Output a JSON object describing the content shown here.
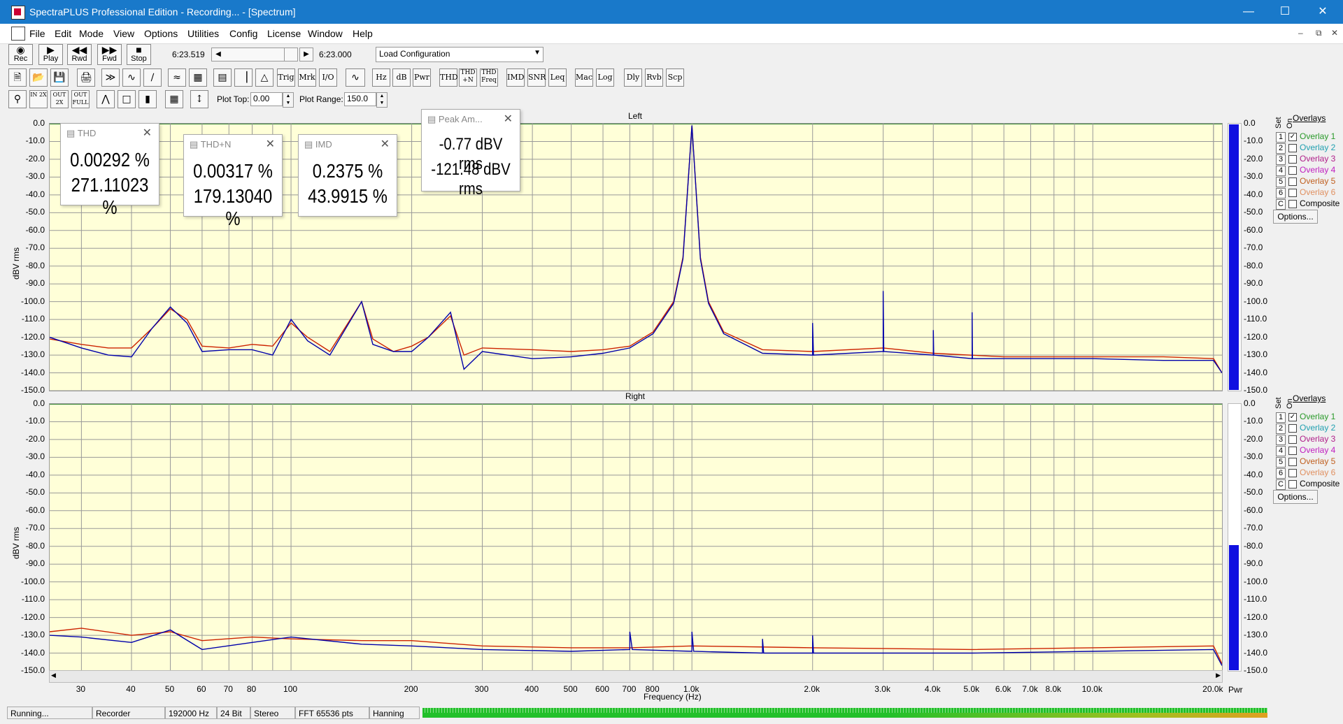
{
  "window": {
    "title": "SpectraPLUS Professional Edition - Recording... - [Spectrum]"
  },
  "menu": [
    "File",
    "Edit",
    "Mode",
    "View",
    "Options",
    "Utilities",
    "Config",
    "License",
    "Window",
    "Help"
  ],
  "transport": {
    "buttons": [
      "Rec",
      "Play",
      "Rwd",
      "Fwd",
      "Stop"
    ],
    "time_left": "6:23.519",
    "time_right": "6:23.000",
    "config_select": "Load Configuration"
  },
  "toolbar2": {
    "text_buttons": [
      "Trig",
      "Mrk",
      "I/O",
      "Hz",
      "dB",
      "Pwr",
      "THD",
      "THD +N",
      "THD Freq",
      "IMD",
      "SNR",
      "Leq",
      "Mac",
      "Log",
      "Dly",
      "Rvb",
      "Scp"
    ]
  },
  "toolbar3": {
    "zoom_buttons": [
      "IN 2X",
      "OUT 2X",
      "OUT FULL"
    ],
    "plot_top_label": "Plot Top:",
    "plot_top_value": "0.00",
    "plot_range_label": "Plot Range:",
    "plot_range_value": "150.0"
  },
  "popups": {
    "thd": {
      "title": "THD",
      "v1": "0.00292 %",
      "v2": "271.11023 %"
    },
    "thdn": {
      "title": "THD+N",
      "v1": "0.00317 %",
      "v2": "179.13040 %"
    },
    "imd": {
      "title": "IMD",
      "v1": "0.2375 %",
      "v2": "43.9915 %"
    },
    "peak": {
      "title": "Peak Am...",
      "v1": "-0.77 dBV rms",
      "v2": "-121.48 dBV rms"
    }
  },
  "overlays": {
    "title": "Overlays",
    "set_label": "Set",
    "on_label": "On",
    "items": [
      {
        "num": "1",
        "label": "Overlay 1",
        "color": "#2a9a2a",
        "checked": true
      },
      {
        "num": "2",
        "label": "Overlay 2",
        "color": "#20a0b0",
        "checked": false
      },
      {
        "num": "3",
        "label": "Overlay 3",
        "color": "#b0208a",
        "checked": false
      },
      {
        "num": "4",
        "label": "Overlay 4",
        "color": "#c020c0",
        "checked": false
      },
      {
        "num": "5",
        "label": "Overlay 5",
        "color": "#c06020",
        "checked": false
      },
      {
        "num": "6",
        "label": "Overlay 6",
        "color": "#e09060",
        "checked": false
      },
      {
        "num": "C",
        "label": "Composite",
        "color": "#000000",
        "checked": false
      }
    ],
    "options_button": "Options..."
  },
  "meters": {
    "left_level": 1.0,
    "right_level": 0.47,
    "pwr_label": "Pwr"
  },
  "status": {
    "state": "Running...",
    "mode": "Recorder",
    "rate": "192000 Hz",
    "bits": "24 Bit",
    "channels": "Stereo",
    "fft": "FFT 65536 pts",
    "window": "Hanning"
  },
  "chart_data": [
    {
      "type": "line",
      "title": "Left",
      "xlabel": "Frequency (Hz)",
      "ylabel": "dBV rms",
      "xscale": "log",
      "xlim": [
        25,
        21000
      ],
      "ylim": [
        -150,
        0
      ],
      "yticks": [
        "0.0",
        "-10.0",
        "-20.0",
        "-30.0",
        "-40.0",
        "-50.0",
        "-60.0",
        "-70.0",
        "-80.0",
        "-90.0",
        "-100.0",
        "-110.0",
        "-120.0",
        "-130.0",
        "-140.0",
        "-150.0"
      ],
      "xticks": [
        "30",
        "40",
        "50",
        "60",
        "70",
        "80",
        "100",
        "200",
        "300",
        "400",
        "500",
        "600",
        "700",
        "800",
        "1.0k",
        "2.0k",
        "3.0k",
        "4.0k",
        "5.0k",
        "6.0k",
        "7.0k",
        "8.0k",
        "10.0k",
        "20.0k"
      ],
      "series": [
        {
          "color": "#cc2200",
          "points": [
            [
              25,
              -121
            ],
            [
              30,
              -124
            ],
            [
              35,
              -126
            ],
            [
              40,
              -126
            ],
            [
              45,
              -115
            ],
            [
              50,
              -104
            ],
            [
              55,
              -110
            ],
            [
              60,
              -125
            ],
            [
              70,
              -126
            ],
            [
              80,
              -124
            ],
            [
              90,
              -125
            ],
            [
              100,
              -112
            ],
            [
              110,
              -120
            ],
            [
              125,
              -128
            ],
            [
              150,
              -100
            ],
            [
              160,
              -121
            ],
            [
              180,
              -128
            ],
            [
              200,
              -125
            ],
            [
              220,
              -120
            ],
            [
              250,
              -108
            ],
            [
              270,
              -130
            ],
            [
              300,
              -126
            ],
            [
              400,
              -127
            ],
            [
              500,
              -128
            ],
            [
              600,
              -127
            ],
            [
              700,
              -125
            ],
            [
              800,
              -117
            ],
            [
              900,
              -100
            ],
            [
              950,
              -75
            ],
            [
              1000,
              -1
            ],
            [
              1050,
              -75
            ],
            [
              1100,
              -100
            ],
            [
              1200,
              -117
            ],
            [
              1500,
              -127
            ],
            [
              2000,
              -128
            ],
            [
              3000,
              -126
            ],
            [
              4000,
              -129
            ],
            [
              6000,
              -131
            ],
            [
              10000,
              -131
            ],
            [
              15000,
              -131
            ],
            [
              20000,
              -132
            ],
            [
              21000,
              -140
            ]
          ]
        },
        {
          "color": "#0000aa",
          "points": [
            [
              25,
              -120
            ],
            [
              30,
              -126
            ],
            [
              35,
              -130
            ],
            [
              40,
              -131
            ],
            [
              45,
              -115
            ],
            [
              50,
              -103
            ],
            [
              55,
              -112
            ],
            [
              60,
              -128
            ],
            [
              70,
              -127
            ],
            [
              80,
              -127
            ],
            [
              90,
              -130
            ],
            [
              100,
              -110
            ],
            [
              110,
              -122
            ],
            [
              125,
              -130
            ],
            [
              150,
              -100
            ],
            [
              160,
              -124
            ],
            [
              180,
              -128
            ],
            [
              200,
              -128
            ],
            [
              220,
              -120
            ],
            [
              250,
              -106
            ],
            [
              270,
              -138
            ],
            [
              300,
              -128
            ],
            [
              400,
              -132
            ],
            [
              500,
              -131
            ],
            [
              600,
              -129
            ],
            [
              700,
              -126
            ],
            [
              800,
              -118
            ],
            [
              900,
              -101
            ],
            [
              950,
              -76
            ],
            [
              1000,
              -1
            ],
            [
              1050,
              -76
            ],
            [
              1100,
              -101
            ],
            [
              1200,
              -118
            ],
            [
              1500,
              -129
            ],
            [
              2000,
              -130
            ],
            [
              2000,
              -112
            ],
            [
              2010,
              -130
            ],
            [
              3000,
              -128
            ],
            [
              3000,
              -94
            ],
            [
              3010,
              -128
            ],
            [
              4000,
              -130
            ],
            [
              4000,
              -116
            ],
            [
              4010,
              -130
            ],
            [
              5000,
              -132
            ],
            [
              5000,
              -106
            ],
            [
              5010,
              -132
            ],
            [
              6000,
              -132
            ],
            [
              10000,
              -132
            ],
            [
              15000,
              -133
            ],
            [
              20000,
              -133
            ],
            [
              21000,
              -140
            ]
          ]
        }
      ]
    },
    {
      "type": "line",
      "title": "Right",
      "xlabel": "Frequency (Hz)",
      "ylabel": "dBV rms",
      "xscale": "log",
      "xlim": [
        25,
        21000
      ],
      "ylim": [
        -150,
        0
      ],
      "yticks": [
        "0.0",
        "-10.0",
        "-20.0",
        "-30.0",
        "-40.0",
        "-50.0",
        "-60.0",
        "-70.0",
        "-80.0",
        "-90.0",
        "-100.0",
        "-110.0",
        "-120.0",
        "-130.0",
        "-140.0",
        "-150.0"
      ],
      "xticks": [
        "30",
        "40",
        "50",
        "60",
        "70",
        "80",
        "100",
        "200",
        "300",
        "400",
        "500",
        "600",
        "700",
        "800",
        "1.0k",
        "2.0k",
        "3.0k",
        "4.0k",
        "5.0k",
        "6.0k",
        "7.0k",
        "8.0k",
        "10.0k",
        "20.0k"
      ],
      "series": [
        {
          "color": "#cc2200",
          "points": [
            [
              25,
              -128
            ],
            [
              30,
              -126
            ],
            [
              40,
              -130
            ],
            [
              50,
              -128
            ],
            [
              60,
              -133
            ],
            [
              80,
              -131
            ],
            [
              100,
              -132
            ],
            [
              150,
              -133
            ],
            [
              200,
              -133
            ],
            [
              300,
              -136
            ],
            [
              500,
              -137
            ],
            [
              700,
              -137
            ],
            [
              1000,
              -136
            ],
            [
              2000,
              -137
            ],
            [
              5000,
              -138
            ],
            [
              10000,
              -137
            ],
            [
              20000,
              -136
            ],
            [
              21000,
              -146
            ]
          ]
        },
        {
          "color": "#0000aa",
          "points": [
            [
              25,
              -130
            ],
            [
              30,
              -131
            ],
            [
              40,
              -134
            ],
            [
              50,
              -127
            ],
            [
              60,
              -138
            ],
            [
              80,
              -134
            ],
            [
              100,
              -131
            ],
            [
              150,
              -135
            ],
            [
              200,
              -136
            ],
            [
              300,
              -138
            ],
            [
              500,
              -139
            ],
            [
              700,
              -138
            ],
            [
              700,
              -128
            ],
            [
              710,
              -138
            ],
            [
              1000,
              -139
            ],
            [
              1000,
              -128
            ],
            [
              1010,
              -139
            ],
            [
              1500,
              -140
            ],
            [
              1500,
              -132
            ],
            [
              1510,
              -140
            ],
            [
              2000,
              -140
            ],
            [
              2000,
              -130
            ],
            [
              2010,
              -140
            ],
            [
              5000,
              -140
            ],
            [
              10000,
              -139
            ],
            [
              20000,
              -138
            ],
            [
              21000,
              -147
            ]
          ]
        }
      ]
    }
  ]
}
